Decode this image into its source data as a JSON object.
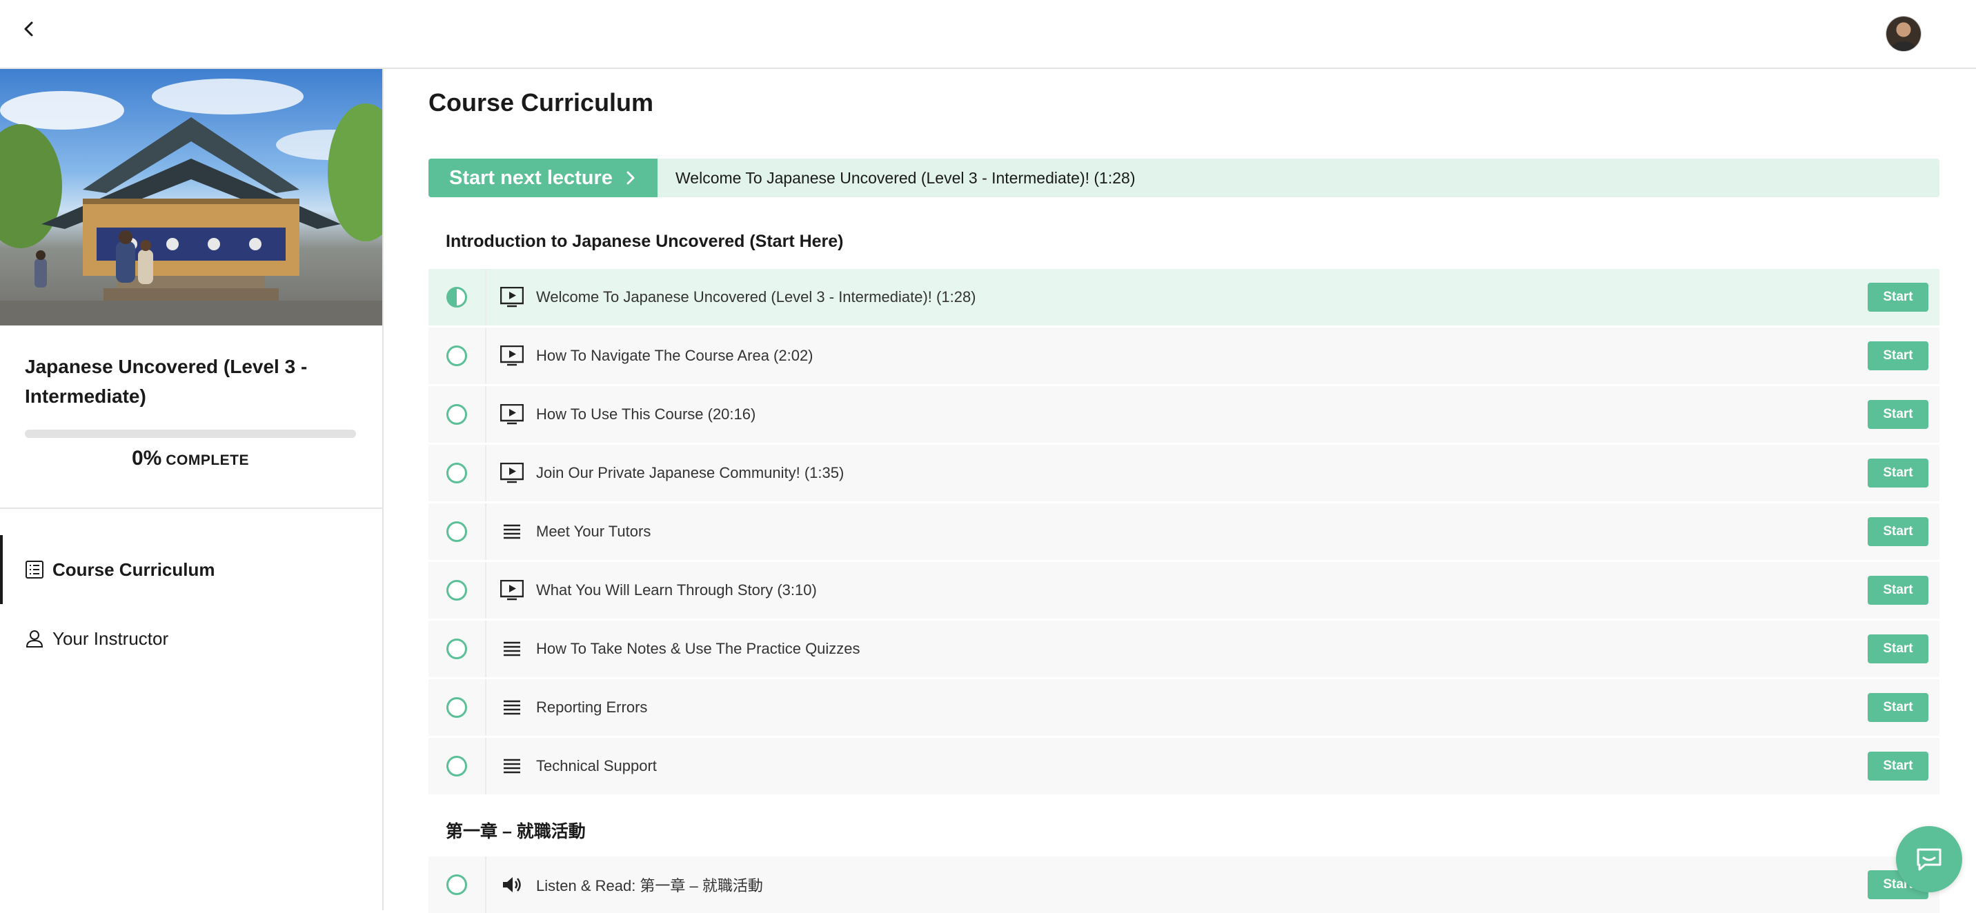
{
  "header": {
    "back_icon": "chevron-left-icon",
    "avatar": "user-avatar"
  },
  "sidebar": {
    "course_title": "Japanese Uncovered (Level 3 - Intermediate)",
    "progress": {
      "percent_value": 0,
      "percent_label": "0%",
      "label": "COMPLETE"
    },
    "nav": [
      {
        "label": "Course Curriculum",
        "icon": "curriculum-icon",
        "active": true
      },
      {
        "label": "Your Instructor",
        "icon": "person-icon",
        "active": false
      }
    ]
  },
  "main": {
    "title": "Course Curriculum",
    "next_lecture": {
      "button_label": "Start next lecture",
      "title": "Welcome To Japanese Uncovered (Level 3 - Intermediate)! (1:28)"
    },
    "sections": [
      {
        "title": "Introduction to Japanese Uncovered (Start Here)",
        "lectures": [
          {
            "title": "Welcome To Japanese Uncovered (Level 3 - Intermediate)! (1:28)",
            "type": "video",
            "status": "in-progress",
            "action": "Start"
          },
          {
            "title": "How To Navigate The Course Area (2:02)",
            "type": "video",
            "status": "not-started",
            "action": "Start"
          },
          {
            "title": "How To Use This Course (20:16)",
            "type": "video",
            "status": "not-started",
            "action": "Start"
          },
          {
            "title": "Join Our Private Japanese Community! (1:35)",
            "type": "video",
            "status": "not-started",
            "action": "Start"
          },
          {
            "title": "Meet Your Tutors",
            "type": "text",
            "status": "not-started",
            "action": "Start"
          },
          {
            "title": "What You Will Learn Through Story (3:10)",
            "type": "video",
            "status": "not-started",
            "action": "Start"
          },
          {
            "title": "How To Take Notes & Use The Practice Quizzes",
            "type": "text",
            "status": "not-started",
            "action": "Start"
          },
          {
            "title": "Reporting Errors",
            "type": "text",
            "status": "not-started",
            "action": "Start"
          },
          {
            "title": "Technical Support",
            "type": "text",
            "status": "not-started",
            "action": "Start"
          }
        ]
      },
      {
        "title": "第一章 – 就職活動",
        "lectures": [
          {
            "title": "Listen & Read: 第一章 – 就職活動",
            "type": "audio",
            "status": "not-started",
            "action": "Start"
          }
        ]
      }
    ]
  },
  "colors": {
    "accent": "#5bbf97",
    "accent_light": "#e2f3ec",
    "row_bg": "#f8f8f8"
  },
  "chat": {
    "icon": "chat-bubble-icon"
  }
}
